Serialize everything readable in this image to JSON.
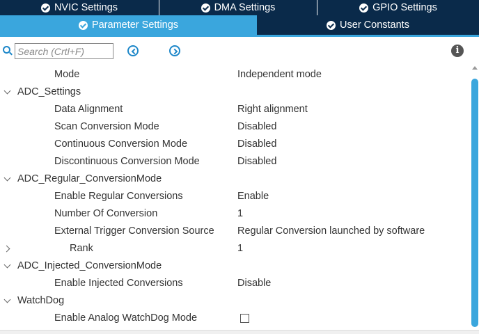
{
  "tabs_row1": [
    {
      "label": "NVIC Settings"
    },
    {
      "label": "DMA Settings"
    },
    {
      "label": "GPIO Settings"
    }
  ],
  "tabs_row2": [
    {
      "label": "Parameter Settings",
      "active": true
    },
    {
      "label": "User Constants",
      "active": false
    }
  ],
  "toolbar": {
    "search_placeholder": "Search (Crtl+F)",
    "info_glyph": "i"
  },
  "params": {
    "mode": {
      "name": "Mode",
      "value": "Independent mode"
    },
    "adc_settings": {
      "name": "ADC_Settings"
    },
    "data_alignment": {
      "name": "Data Alignment",
      "value": "Right alignment"
    },
    "scan_mode": {
      "name": "Scan Conversion Mode",
      "value": "Disabled"
    },
    "continuous_mode": {
      "name": "Continuous Conversion Mode",
      "value": "Disabled"
    },
    "discontinuous_mode": {
      "name": "Discontinuous Conversion Mode",
      "value": "Disabled"
    },
    "regular_group": {
      "name": "ADC_Regular_ConversionMode"
    },
    "enable_regular": {
      "name": "Enable Regular Conversions",
      "value": "Enable"
    },
    "number_of_conversion": {
      "name": "Number Of Conversion",
      "value": "1"
    },
    "external_trigger": {
      "name": "External Trigger Conversion Source",
      "value": "Regular Conversion launched by software"
    },
    "rank": {
      "name": "Rank",
      "value": "1"
    },
    "injected_group": {
      "name": "ADC_Injected_ConversionMode"
    },
    "enable_injected": {
      "name": "Enable Injected Conversions",
      "value": "Disable"
    },
    "watchdog_group": {
      "name": "WatchDog"
    },
    "analog_watchdog": {
      "name": "Enable Analog WatchDog Mode",
      "checked": false
    }
  },
  "colors": {
    "tab_dark": "#0a2a4a",
    "tab_active": "#3aa6dd",
    "accent_icon": "#1d87c9",
    "text": "#333333"
  }
}
